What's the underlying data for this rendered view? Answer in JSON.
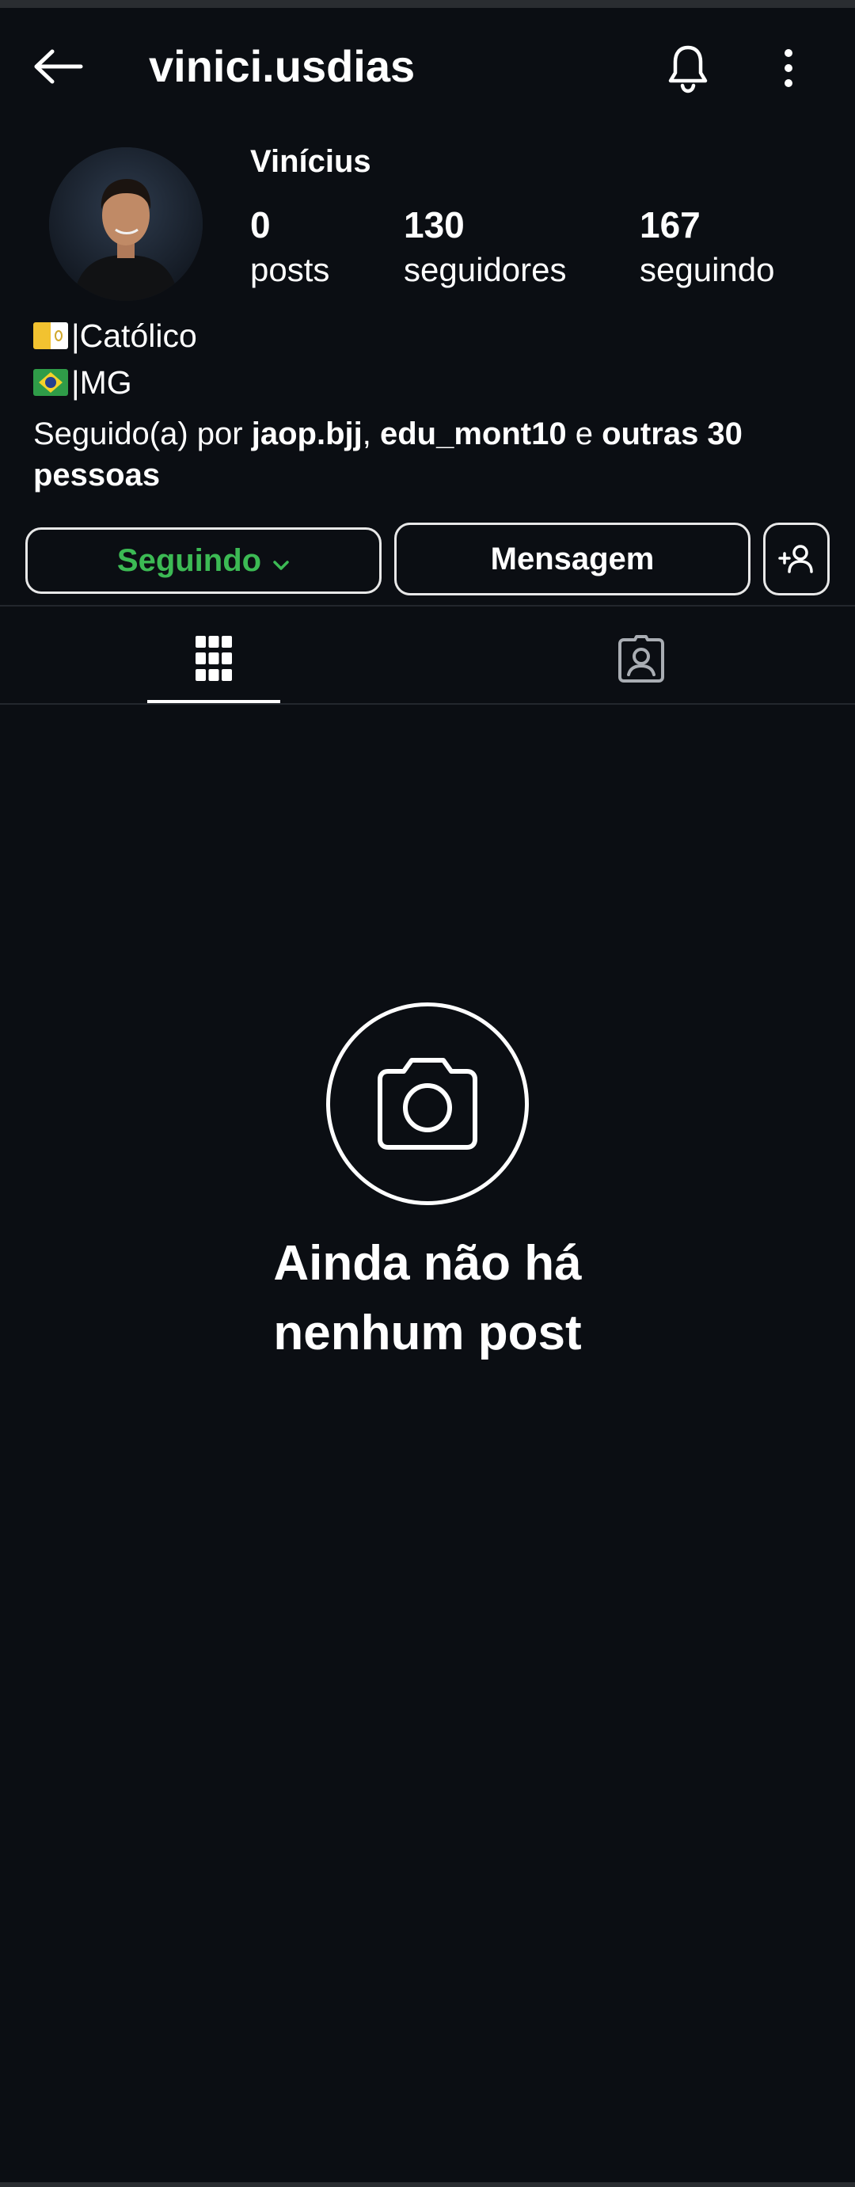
{
  "header": {
    "username": "vinici.usdias",
    "back_icon": "arrow-left-icon",
    "bell_icon": "bell-icon",
    "more_icon": "more-vertical-icon"
  },
  "profile": {
    "display_name": "Vinícius",
    "stats": {
      "posts_count": "0",
      "posts_label": "posts",
      "followers_count": "130",
      "followers_label": "seguidores",
      "following_count": "167",
      "following_label": "seguindo"
    },
    "bio": {
      "line1_text": "|Católico",
      "line2_text": "|MG"
    },
    "followed_by": {
      "prefix": "Seguido(a) por ",
      "user1": "jaop.bjj",
      "sep": ", ",
      "user2": "edu_mont10",
      "conj": " e ",
      "others": "outras 30 pessoas"
    }
  },
  "actions": {
    "following_label": "Seguindo",
    "message_label": "Mensagem",
    "following_color": "#3cba54"
  },
  "tabs": {
    "grid_icon": "grid-icon",
    "tagged_icon": "tagged-user-icon",
    "active": "grid"
  },
  "empty_state": {
    "icon": "camera-icon",
    "title": "Ainda não há nenhum post"
  },
  "colors": {
    "background": "#0b0e13",
    "text": "#ffffff",
    "accent_green": "#3cba54"
  }
}
